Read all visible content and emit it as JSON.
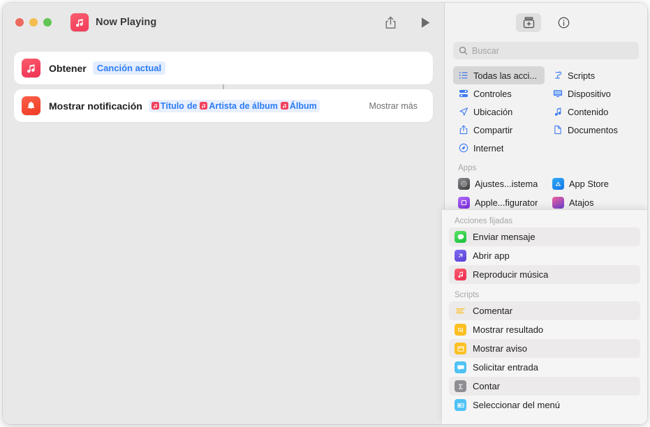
{
  "window": {
    "title": "Now Playing",
    "app_icon": "music-note-icon",
    "traffic_lights": [
      "close",
      "minimize",
      "maximize"
    ],
    "colors": {
      "accent_blue": "#2b7cf6",
      "token_bg": "#e4edfd",
      "music_red": "#f2415c",
      "notify_red": "#ef3a24",
      "window_bg": "#e9e8e8",
      "sidebar_bg": "#f3f2f2",
      "overlay_bg": "#f6f5f5"
    }
  },
  "titlebar_actions": [
    {
      "name": "share-icon",
      "label": "Compartir"
    },
    {
      "name": "play-icon",
      "label": "Ejecutar"
    }
  ],
  "canvas": {
    "actions": [
      {
        "icon": "music-app-icon",
        "label": "Obtener",
        "token": "Canción actual",
        "show_more": ""
      },
      {
        "icon": "notification-bell-icon",
        "label": "Mostrar notificación",
        "parameters": [
          {
            "type": "variable",
            "glyph": "music-note-icon",
            "text": "Título"
          },
          {
            "type": "text",
            "text": "de"
          },
          {
            "type": "variable",
            "glyph": "music-note-icon",
            "text": "Artista"
          },
          {
            "type": "text",
            "text": "de álbum"
          },
          {
            "type": "variable",
            "glyph": "music-note-icon",
            "text": "Álbum"
          }
        ],
        "show_more": "Mostrar más"
      }
    ]
  },
  "sidebar": {
    "toolbar": [
      {
        "name": "action-library-icon",
        "label": "Biblioteca de acciones",
        "active": true
      },
      {
        "name": "info-circle-icon",
        "label": "Información",
        "active": false
      }
    ],
    "search": {
      "placeholder": "Buscar",
      "value": ""
    },
    "categories": [
      {
        "label": "Todas las acci...",
        "icon": "list-bullet-icon",
        "selected": true
      },
      {
        "label": "Scripts",
        "icon": "scripts-icon",
        "selected": false
      },
      {
        "label": "Controles",
        "icon": "controls-icon",
        "selected": false
      },
      {
        "label": "Dispositivo",
        "icon": "display-icon",
        "selected": false
      },
      {
        "label": "Ubicación",
        "icon": "location-arrow-icon",
        "selected": false
      },
      {
        "label": "Contenido",
        "icon": "music-note-icon",
        "selected": false
      },
      {
        "label": "Compartir",
        "icon": "share-icon",
        "selected": false
      },
      {
        "label": "Documentos",
        "icon": "document-icon",
        "selected": false
      },
      {
        "label": "Internet",
        "icon": "safari-compass-icon",
        "selected": false
      }
    ],
    "apps_header": "Apps",
    "apps": [
      {
        "label": "Ajustes...istema",
        "icon": "system-settings-icon"
      },
      {
        "label": "App Store",
        "icon": "app-store-icon"
      },
      {
        "label": "Apple...figurator",
        "icon": "apple-configurator-icon"
      },
      {
        "label": "Atajos",
        "icon": "shortcuts-icon"
      }
    ]
  },
  "overlay": {
    "pinned_header": "Acciones fijadas",
    "pinned": [
      {
        "label": "Enviar mensaje",
        "icon": "messages-icon",
        "alt": true
      },
      {
        "label": "Abrir app",
        "icon": "open-app-icon",
        "alt": false
      },
      {
        "label": "Reproducir música",
        "icon": "music-note-icon",
        "alt": true
      }
    ],
    "scripts_header": "Scripts",
    "scripts": [
      {
        "label": "Comentar",
        "icon": "comment-lines-icon",
        "alt": true
      },
      {
        "label": "Mostrar resultado",
        "icon": "show-result-icon",
        "alt": false
      },
      {
        "label": "Mostrar aviso",
        "icon": "show-alert-icon",
        "alt": true
      },
      {
        "label": "Solicitar entrada",
        "icon": "ask-input-icon",
        "alt": false
      },
      {
        "label": "Contar",
        "icon": "sigma-count-icon",
        "alt": true
      },
      {
        "label": "Seleccionar del menú",
        "icon": "choose-menu-icon",
        "alt": false
      }
    ]
  }
}
